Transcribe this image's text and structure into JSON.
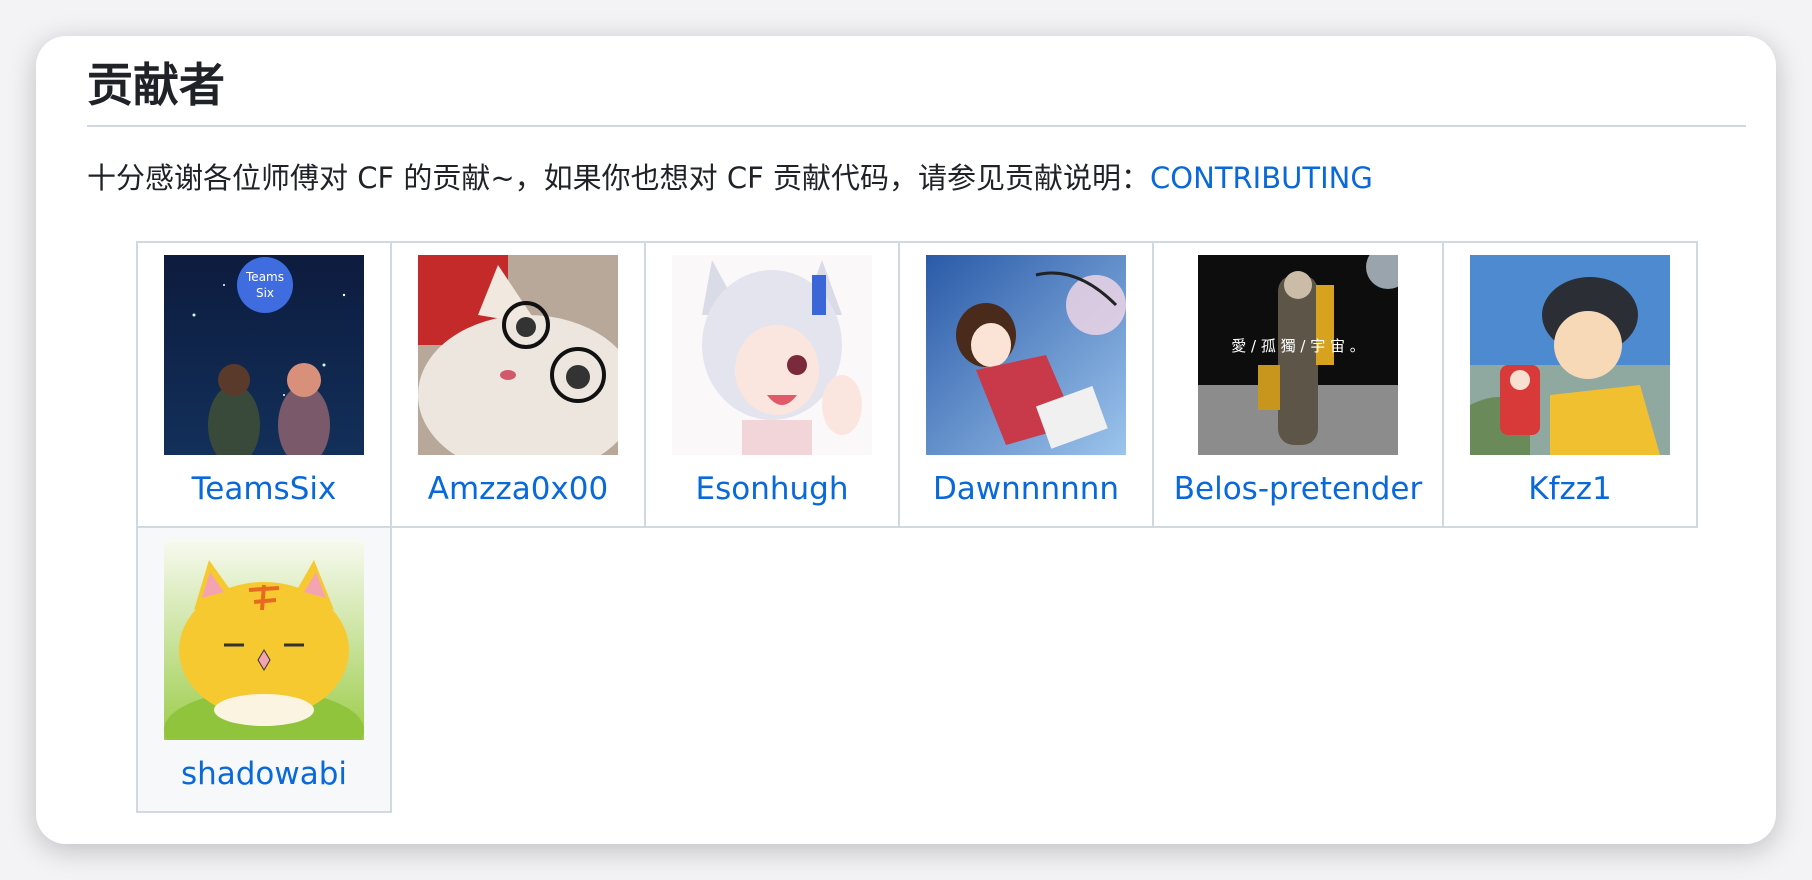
{
  "section": {
    "title": "贡献者",
    "intro_text": "十分感谢各位师傅对 CF 的贡献~，如果你也想对 CF 贡献代码，请参见贡献说明：",
    "intro_link": "CONTRIBUTING"
  },
  "contributors": [
    {
      "name": "TeamsSix",
      "avatar_text_line1": "Teams",
      "avatar_text_line2": "Six",
      "avatar_icon": "night-sky-avatar"
    },
    {
      "name": "Amzza0x00",
      "avatar_icon": "cat-with-glasses-avatar"
    },
    {
      "name": "Esonhugh",
      "avatar_icon": "anime-girl-avatar"
    },
    {
      "name": "Dawnnnnnn",
      "avatar_icon": "anime-girl-sky-avatar"
    },
    {
      "name": "Belos-pretender",
      "avatar_text_line1": "愛 / 孤 獨 / 宇 宙 。",
      "avatar_icon": "moon-soldier-avatar"
    },
    {
      "name": "Kfzz1",
      "avatar_icon": "boy-by-sea-avatar"
    },
    {
      "name": "shadowabi",
      "avatar_icon": "yellow-cat-avatar"
    }
  ],
  "colors": {
    "link": "#0969da",
    "text": "#1f2328",
    "border": "#d1d9e0"
  }
}
